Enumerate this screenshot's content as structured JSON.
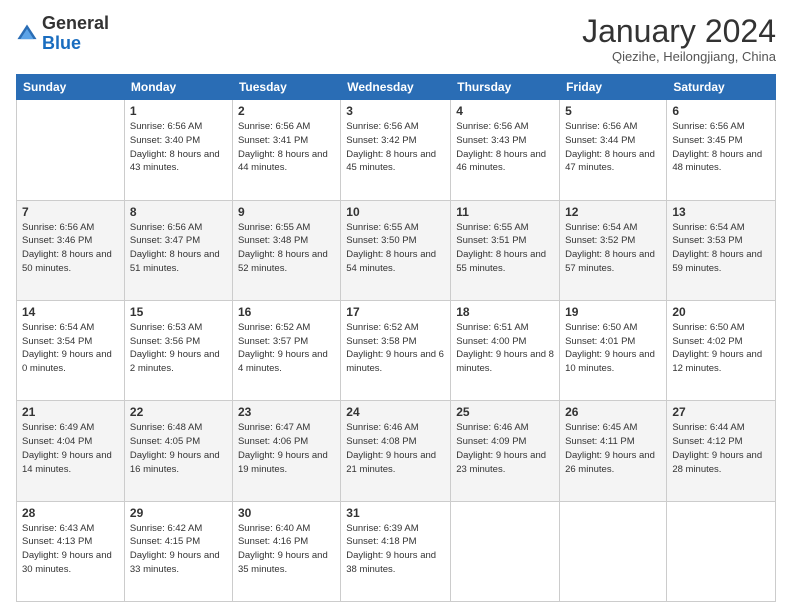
{
  "header": {
    "logo_line1": "General",
    "logo_line2": "Blue",
    "month_title": "January 2024",
    "subtitle": "Qiezihe, Heilongjiang, China"
  },
  "weekdays": [
    "Sunday",
    "Monday",
    "Tuesday",
    "Wednesday",
    "Thursday",
    "Friday",
    "Saturday"
  ],
  "weeks": [
    [
      {
        "day": "",
        "sunrise": "",
        "sunset": "",
        "daylight": ""
      },
      {
        "day": "1",
        "sunrise": "Sunrise: 6:56 AM",
        "sunset": "Sunset: 3:40 PM",
        "daylight": "Daylight: 8 hours and 43 minutes."
      },
      {
        "day": "2",
        "sunrise": "Sunrise: 6:56 AM",
        "sunset": "Sunset: 3:41 PM",
        "daylight": "Daylight: 8 hours and 44 minutes."
      },
      {
        "day": "3",
        "sunrise": "Sunrise: 6:56 AM",
        "sunset": "Sunset: 3:42 PM",
        "daylight": "Daylight: 8 hours and 45 minutes."
      },
      {
        "day": "4",
        "sunrise": "Sunrise: 6:56 AM",
        "sunset": "Sunset: 3:43 PM",
        "daylight": "Daylight: 8 hours and 46 minutes."
      },
      {
        "day": "5",
        "sunrise": "Sunrise: 6:56 AM",
        "sunset": "Sunset: 3:44 PM",
        "daylight": "Daylight: 8 hours and 47 minutes."
      },
      {
        "day": "6",
        "sunrise": "Sunrise: 6:56 AM",
        "sunset": "Sunset: 3:45 PM",
        "daylight": "Daylight: 8 hours and 48 minutes."
      }
    ],
    [
      {
        "day": "7",
        "sunrise": "Sunrise: 6:56 AM",
        "sunset": "Sunset: 3:46 PM",
        "daylight": "Daylight: 8 hours and 50 minutes."
      },
      {
        "day": "8",
        "sunrise": "Sunrise: 6:56 AM",
        "sunset": "Sunset: 3:47 PM",
        "daylight": "Daylight: 8 hours and 51 minutes."
      },
      {
        "day": "9",
        "sunrise": "Sunrise: 6:55 AM",
        "sunset": "Sunset: 3:48 PM",
        "daylight": "Daylight: 8 hours and 52 minutes."
      },
      {
        "day": "10",
        "sunrise": "Sunrise: 6:55 AM",
        "sunset": "Sunset: 3:50 PM",
        "daylight": "Daylight: 8 hours and 54 minutes."
      },
      {
        "day": "11",
        "sunrise": "Sunrise: 6:55 AM",
        "sunset": "Sunset: 3:51 PM",
        "daylight": "Daylight: 8 hours and 55 minutes."
      },
      {
        "day": "12",
        "sunrise": "Sunrise: 6:54 AM",
        "sunset": "Sunset: 3:52 PM",
        "daylight": "Daylight: 8 hours and 57 minutes."
      },
      {
        "day": "13",
        "sunrise": "Sunrise: 6:54 AM",
        "sunset": "Sunset: 3:53 PM",
        "daylight": "Daylight: 8 hours and 59 minutes."
      }
    ],
    [
      {
        "day": "14",
        "sunrise": "Sunrise: 6:54 AM",
        "sunset": "Sunset: 3:54 PM",
        "daylight": "Daylight: 9 hours and 0 minutes."
      },
      {
        "day": "15",
        "sunrise": "Sunrise: 6:53 AM",
        "sunset": "Sunset: 3:56 PM",
        "daylight": "Daylight: 9 hours and 2 minutes."
      },
      {
        "day": "16",
        "sunrise": "Sunrise: 6:52 AM",
        "sunset": "Sunset: 3:57 PM",
        "daylight": "Daylight: 9 hours and 4 minutes."
      },
      {
        "day": "17",
        "sunrise": "Sunrise: 6:52 AM",
        "sunset": "Sunset: 3:58 PM",
        "daylight": "Daylight: 9 hours and 6 minutes."
      },
      {
        "day": "18",
        "sunrise": "Sunrise: 6:51 AM",
        "sunset": "Sunset: 4:00 PM",
        "daylight": "Daylight: 9 hours and 8 minutes."
      },
      {
        "day": "19",
        "sunrise": "Sunrise: 6:50 AM",
        "sunset": "Sunset: 4:01 PM",
        "daylight": "Daylight: 9 hours and 10 minutes."
      },
      {
        "day": "20",
        "sunrise": "Sunrise: 6:50 AM",
        "sunset": "Sunset: 4:02 PM",
        "daylight": "Daylight: 9 hours and 12 minutes."
      }
    ],
    [
      {
        "day": "21",
        "sunrise": "Sunrise: 6:49 AM",
        "sunset": "Sunset: 4:04 PM",
        "daylight": "Daylight: 9 hours and 14 minutes."
      },
      {
        "day": "22",
        "sunrise": "Sunrise: 6:48 AM",
        "sunset": "Sunset: 4:05 PM",
        "daylight": "Daylight: 9 hours and 16 minutes."
      },
      {
        "day": "23",
        "sunrise": "Sunrise: 6:47 AM",
        "sunset": "Sunset: 4:06 PM",
        "daylight": "Daylight: 9 hours and 19 minutes."
      },
      {
        "day": "24",
        "sunrise": "Sunrise: 6:46 AM",
        "sunset": "Sunset: 4:08 PM",
        "daylight": "Daylight: 9 hours and 21 minutes."
      },
      {
        "day": "25",
        "sunrise": "Sunrise: 6:46 AM",
        "sunset": "Sunset: 4:09 PM",
        "daylight": "Daylight: 9 hours and 23 minutes."
      },
      {
        "day": "26",
        "sunrise": "Sunrise: 6:45 AM",
        "sunset": "Sunset: 4:11 PM",
        "daylight": "Daylight: 9 hours and 26 minutes."
      },
      {
        "day": "27",
        "sunrise": "Sunrise: 6:44 AM",
        "sunset": "Sunset: 4:12 PM",
        "daylight": "Daylight: 9 hours and 28 minutes."
      }
    ],
    [
      {
        "day": "28",
        "sunrise": "Sunrise: 6:43 AM",
        "sunset": "Sunset: 4:13 PM",
        "daylight": "Daylight: 9 hours and 30 minutes."
      },
      {
        "day": "29",
        "sunrise": "Sunrise: 6:42 AM",
        "sunset": "Sunset: 4:15 PM",
        "daylight": "Daylight: 9 hours and 33 minutes."
      },
      {
        "day": "30",
        "sunrise": "Sunrise: 6:40 AM",
        "sunset": "Sunset: 4:16 PM",
        "daylight": "Daylight: 9 hours and 35 minutes."
      },
      {
        "day": "31",
        "sunrise": "Sunrise: 6:39 AM",
        "sunset": "Sunset: 4:18 PM",
        "daylight": "Daylight: 9 hours and 38 minutes."
      },
      {
        "day": "",
        "sunrise": "",
        "sunset": "",
        "daylight": ""
      },
      {
        "day": "",
        "sunrise": "",
        "sunset": "",
        "daylight": ""
      },
      {
        "day": "",
        "sunrise": "",
        "sunset": "",
        "daylight": ""
      }
    ]
  ]
}
